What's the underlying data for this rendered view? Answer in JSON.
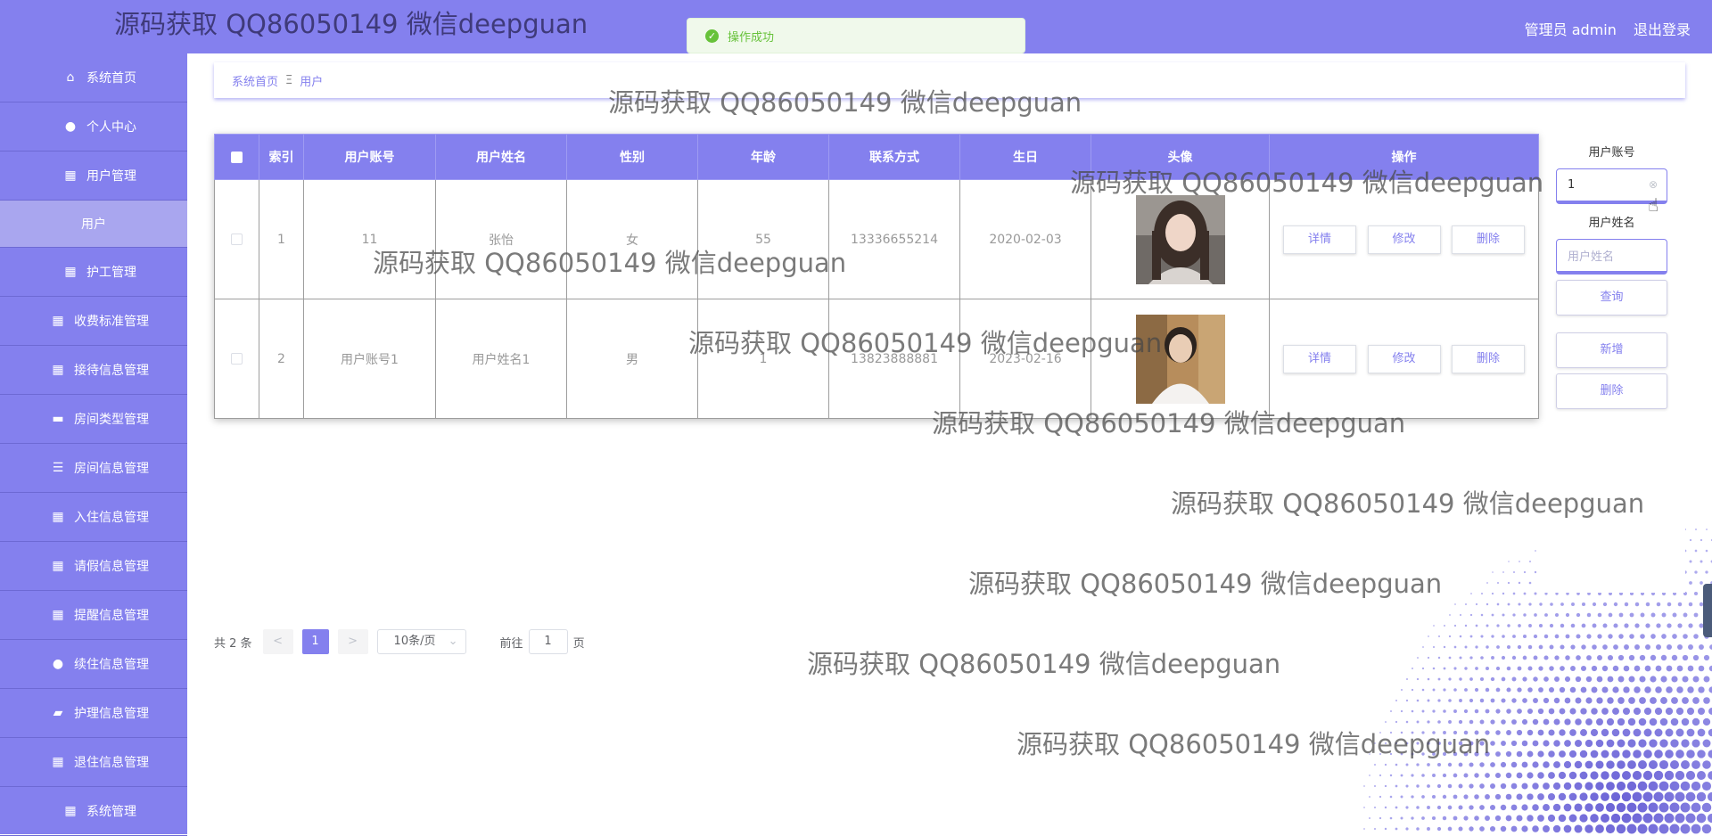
{
  "header": {
    "site_title": "源码获取 QQ86050149 微信deepguan",
    "admin_label": "管理员 admin",
    "logout_label": "退出登录",
    "colors": {
      "primary": "#8480ee",
      "success": "#67c23a"
    }
  },
  "toast": {
    "message": "操作成功",
    "icon": "check-circle-icon"
  },
  "sidebar": {
    "items": [
      {
        "label": "系统首页",
        "icon": "home-icon"
      },
      {
        "label": "个人中心",
        "icon": "user-icon"
      },
      {
        "label": "用户管理",
        "icon": "grid-icon"
      },
      {
        "label": "用户",
        "sub": true
      },
      {
        "label": "护工管理",
        "icon": "grid-icon"
      },
      {
        "label": "收费标准管理",
        "icon": "grid-icon"
      },
      {
        "label": "接待信息管理",
        "icon": "grid-icon"
      },
      {
        "label": "房间类型管理",
        "icon": "briefcase-icon"
      },
      {
        "label": "房间信息管理",
        "icon": "list-icon"
      },
      {
        "label": "入住信息管理",
        "icon": "grid-icon"
      },
      {
        "label": "请假信息管理",
        "icon": "table-icon"
      },
      {
        "label": "提醒信息管理",
        "icon": "grid-icon"
      },
      {
        "label": "续住信息管理",
        "icon": "user-icon"
      },
      {
        "label": "护理信息管理",
        "icon": "ticket-icon"
      },
      {
        "label": "退住信息管理",
        "icon": "grid-icon"
      },
      {
        "label": "系统管理",
        "icon": "grid-icon"
      }
    ]
  },
  "breadcrumb": {
    "home": "系统首页",
    "separator": "Ξ",
    "current": "用户"
  },
  "table": {
    "columns": [
      "索引",
      "用户账号",
      "用户姓名",
      "性别",
      "年龄",
      "联系方式",
      "生日",
      "头像",
      "操作"
    ],
    "rows": [
      {
        "index": "1",
        "account": "11",
        "name": "张怡",
        "gender": "女",
        "age": "55",
        "phone": "13336655214",
        "birthday": "2020-02-03",
        "avatar": "female-avatar"
      },
      {
        "index": "2",
        "account": "用户账号1",
        "name": "用户姓名1",
        "gender": "男",
        "age": "1",
        "phone": "13823888881",
        "birthday": "2023-02-16",
        "avatar": "male-avatar"
      }
    ],
    "actions": {
      "detail": "详情",
      "edit": "修改",
      "delete": "删除"
    }
  },
  "search": {
    "account_label": "用户账号",
    "account_value": "1",
    "name_label": "用户姓名",
    "name_placeholder": "用户姓名",
    "query_button": "查询",
    "add_button": "新增",
    "delete_button": "删除"
  },
  "pagination": {
    "total_text": "共 2 条",
    "prev": "<",
    "current_page": "1",
    "next": ">",
    "page_size": "10条/页",
    "goto_prefix": "前往",
    "goto_value": "1",
    "goto_suffix": "页"
  },
  "watermark": "源码获取 QQ86050149 微信deepguan"
}
